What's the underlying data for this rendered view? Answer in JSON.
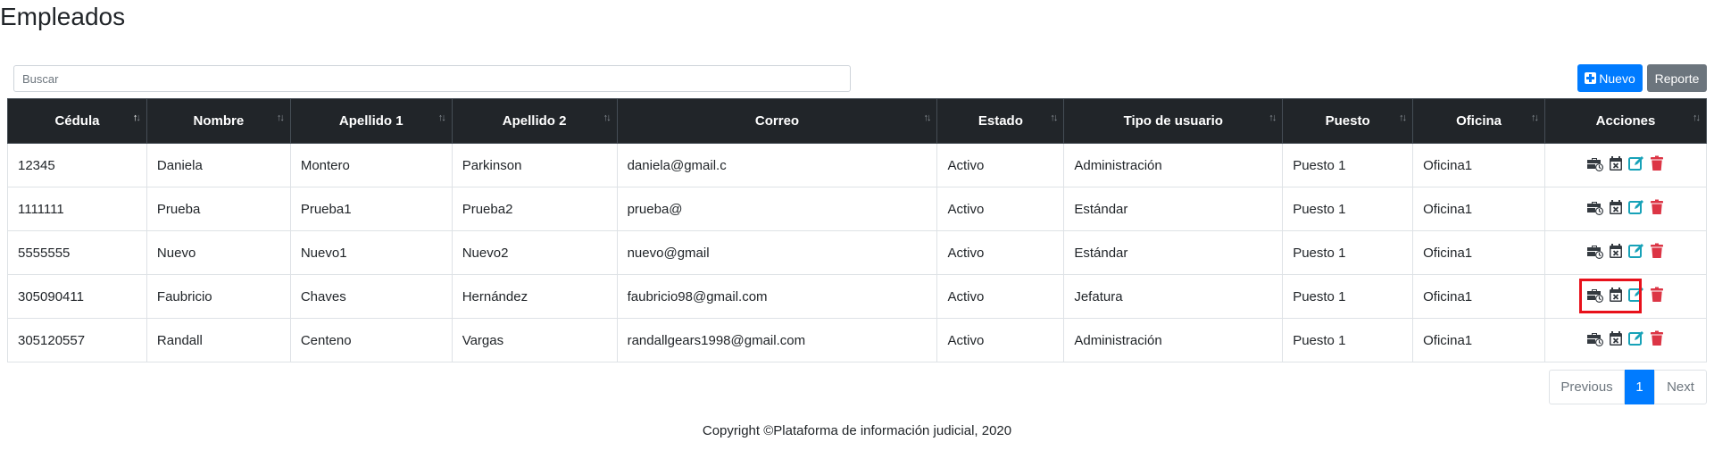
{
  "page": {
    "title": "Empleados"
  },
  "search": {
    "placeholder": "Buscar",
    "value": ""
  },
  "toolbar": {
    "new_label": "Nuevo",
    "report_label": "Reporte"
  },
  "table": {
    "columns": [
      "Cédula",
      "Nombre",
      "Apellido 1",
      "Apellido 2",
      "Correo",
      "Estado",
      "Tipo de usuario",
      "Puesto",
      "Oficina",
      "Acciones"
    ],
    "sorted_column": "Cédula",
    "rows": [
      [
        "12345",
        "Daniela",
        "Montero",
        "Parkinson",
        "daniela@gmail.c",
        "Activo",
        "Administración",
        "Puesto 1",
        "Oficina1"
      ],
      [
        "1111111",
        "Prueba",
        "Prueba1",
        "Prueba2",
        "prueba@",
        "Activo",
        "Estándar",
        "Puesto 1",
        "Oficina1"
      ],
      [
        "5555555",
        "Nuevo",
        "Nuevo1",
        "Nuevo2",
        "nuevo@gmail",
        "Activo",
        "Estándar",
        "Puesto 1",
        "Oficina1"
      ],
      [
        "305090411",
        "Faubricio",
        "Chaves",
        "Hernández",
        "faubricio98@gmail.com",
        "Activo",
        "Jefatura",
        "Puesto 1",
        "Oficina1"
      ],
      [
        "305120557",
        "Randall",
        "Centeno",
        "Vargas",
        "randallgears1998@gmail.com",
        "Activo",
        "Administración",
        "Puesto 1",
        "Oficina1"
      ]
    ],
    "row_actions": [
      "briefcase-clock-icon",
      "calendar-x-icon",
      "edit-icon",
      "trash-icon"
    ],
    "highlighted_row": 3
  },
  "pagination": {
    "previous_label": "Previous",
    "current_page": "1",
    "next_label": "Next"
  },
  "footer": {
    "text": "Copyright ©Plataforma de información judicial, 2020"
  },
  "colors": {
    "primary": "#007bff",
    "secondary": "#6c757d",
    "header_bg": "#212529",
    "edit": "#17a2b8",
    "delete": "#dc3545",
    "highlight": "#e8111b"
  }
}
